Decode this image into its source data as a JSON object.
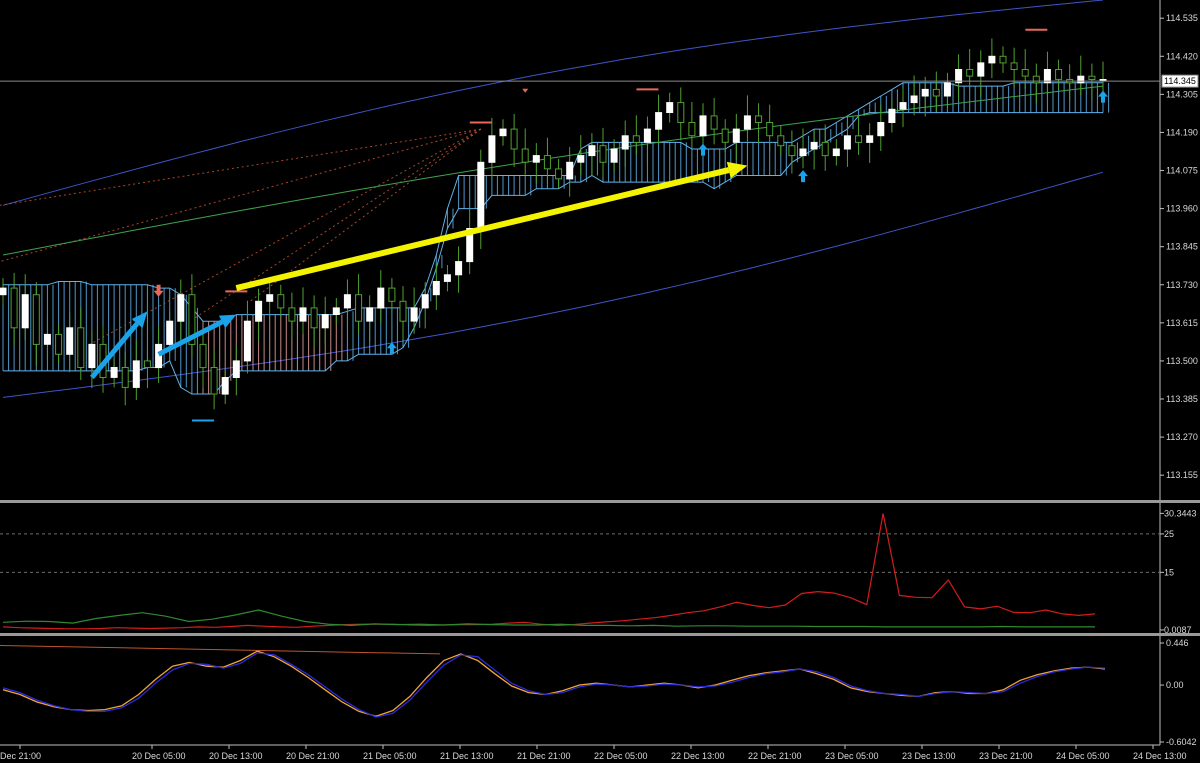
{
  "colors": {
    "background": "#000000",
    "axis": "#bfbfbf",
    "grid_dash": "#6e6e6e",
    "bull_candle": "#ffffff",
    "bear_candle": "#000000",
    "wick": "#4fa030",
    "cloud_bull": "#5fb2ea",
    "cloud_bear": "#e8a2a2",
    "bands": "#3f55c8",
    "ma": "#3fa34d",
    "fib_fan": "#b94f2c",
    "arrow_blue": "#1aa3e8",
    "arrow_yellow": "#f4f400",
    "fractal_up": "#e9685a",
    "fractal_down": "#1aa3e8",
    "adx_red": "#d21d1d",
    "adx_green": "#2f8a2f",
    "osc_orange": "#f0a43a",
    "osc_blue": "#2b2bd8"
  },
  "chart_data": [
    {
      "panel": "price",
      "type": "candlestick",
      "ylim": [
        113.08,
        114.59
      ],
      "tick_labels": [
        "114.535",
        "114.420",
        "114.305",
        "114.190",
        "114.075",
        "113.960",
        "113.845",
        "113.730",
        "113.615",
        "113.500",
        "113.385",
        "113.270",
        "113.155"
      ],
      "current_price_label": "114.345",
      "current_price": 114.345,
      "x_tick_labels": [
        "Dec 21:00",
        "20 Dec 05:00",
        "20 Dec 13:00",
        "20 Dec 21:00",
        "21 Dec 05:00",
        "21 Dec 13:00",
        "21 Dec 21:00",
        "22 Dec 05:00",
        "22 Dec 13:00",
        "22 Dec 21:00",
        "23 Dec 05:00",
        "23 Dec 13:00",
        "23 Dec 21:00",
        "24 Dec 05:00",
        "24 Dec 13:00"
      ],
      "closes": [
        113.72,
        113.6,
        113.7,
        113.55,
        113.58,
        113.52,
        113.6,
        113.48,
        113.55,
        113.45,
        113.48,
        113.42,
        113.5,
        113.48,
        113.55,
        113.62,
        113.7,
        113.55,
        113.48,
        113.4,
        113.45,
        113.5,
        113.62,
        113.68,
        113.7,
        113.66,
        113.62,
        113.66,
        113.6,
        113.64,
        113.66,
        113.7,
        113.62,
        113.66,
        113.72,
        113.68,
        113.62,
        113.66,
        113.7,
        113.74,
        113.76,
        113.8,
        113.9,
        114.1,
        114.18,
        114.2,
        114.14,
        114.1,
        114.12,
        114.08,
        114.05,
        114.1,
        114.12,
        114.15,
        114.1,
        114.14,
        114.18,
        114.16,
        114.2,
        114.25,
        114.28,
        114.22,
        114.18,
        114.24,
        114.2,
        114.16,
        114.2,
        114.24,
        114.22,
        114.18,
        114.15,
        114.12,
        114.14,
        114.16,
        114.12,
        114.14,
        114.18,
        114.16,
        114.18,
        114.22,
        114.26,
        114.28,
        114.3,
        114.32,
        114.3,
        114.34,
        114.38,
        114.36,
        114.4,
        114.42,
        114.4,
        114.38,
        114.36,
        114.34,
        114.38,
        114.35,
        114.34,
        114.36,
        114.35,
        114.35
      ],
      "cloud": {
        "top": [
          113.73,
          113.73,
          113.73,
          113.73,
          113.73,
          113.74,
          113.74,
          113.74,
          113.73,
          113.73,
          113.73,
          113.73,
          113.73,
          113.73,
          113.72,
          113.72,
          113.7,
          113.66,
          113.62,
          113.62,
          113.62,
          113.64,
          113.64,
          113.64,
          113.64,
          113.64,
          113.64,
          113.64,
          113.64,
          113.64,
          113.64,
          113.65,
          113.66,
          113.66,
          113.66,
          113.66,
          113.66,
          113.66,
          113.72,
          113.82,
          113.96,
          114.06,
          114.06,
          114.06,
          114.06,
          114.06,
          114.06,
          114.06,
          114.06,
          114.06,
          114.06,
          114.06,
          114.14,
          114.16,
          114.16,
          114.16,
          114.16,
          114.16,
          114.16,
          114.16,
          114.16,
          114.16,
          114.14,
          114.14,
          114.14,
          114.14,
          114.16,
          114.16,
          114.16,
          114.16,
          114.16,
          114.16,
          114.18,
          114.2,
          114.2,
          114.22,
          114.24,
          114.26,
          114.28,
          114.3,
          114.32,
          114.34,
          114.34,
          114.34,
          114.34,
          114.34,
          114.33,
          114.33,
          114.33,
          114.33,
          114.33,
          114.34,
          114.34,
          114.34,
          114.34,
          114.34,
          114.34,
          114.34,
          114.34,
          114.34
        ],
        "bottom": [
          113.47,
          113.47,
          113.47,
          113.47,
          113.47,
          113.47,
          113.47,
          113.47,
          113.47,
          113.47,
          113.47,
          113.47,
          113.47,
          113.48,
          113.48,
          113.5,
          113.42,
          113.4,
          113.4,
          113.4,
          113.44,
          113.47,
          113.47,
          113.47,
          113.47,
          113.47,
          113.47,
          113.47,
          113.47,
          113.47,
          113.5,
          113.5,
          113.52,
          113.52,
          113.52,
          113.52,
          113.54,
          113.6,
          113.68,
          113.78,
          113.9,
          113.96,
          113.96,
          113.96,
          114.0,
          114.0,
          114.0,
          114.0,
          114.02,
          114.02,
          114.02,
          114.04,
          114.04,
          114.06,
          114.04,
          114.04,
          114.04,
          114.04,
          114.04,
          114.04,
          114.04,
          114.04,
          114.04,
          114.04,
          114.02,
          114.04,
          114.06,
          114.06,
          114.06,
          114.06,
          114.06,
          114.1,
          114.12,
          114.14,
          114.16,
          114.18,
          114.2,
          114.24,
          114.25,
          114.25,
          114.25,
          114.25,
          114.25,
          114.25,
          114.25,
          114.25,
          114.25,
          114.25,
          114.25,
          114.25,
          114.25,
          114.25,
          114.25,
          114.25,
          114.25,
          114.25,
          114.25,
          114.25,
          114.25,
          114.25
        ]
      },
      "bollinger_upper_start": 113.97,
      "bollinger_upper_end": 114.59,
      "bollinger_lower_start": 113.39,
      "bollinger_lower_end": 114.07,
      "ma_start": 113.82,
      "ma_end": 114.33
    },
    {
      "panel": "adx",
      "type": "line",
      "ylim": [
        0,
        32
      ],
      "tick_labels": [
        "30.3443",
        "25",
        "15",
        "0.0087"
      ],
      "levels": [
        25,
        15
      ],
      "series": [
        {
          "values": [
            0.8,
            0.6,
            0.5,
            0.4,
            0.3,
            0.3,
            0.4,
            0.6,
            0.5,
            0.4,
            0.5,
            0.6,
            0.8,
            0.7,
            0.9,
            1.2,
            1.0,
            0.8,
            0.7,
            1.0,
            1.2,
            1.4,
            1.5,
            1.5,
            1.5,
            1.3,
            1.2,
            1.3,
            1.4,
            1.4,
            1.5,
            1.8,
            2.0,
            1.5,
            1.2,
            1.4,
            1.8,
            2.1,
            2.4,
            2.8,
            3.2,
            3.8,
            4.5,
            5.0,
            6.0,
            7.2,
            6.4,
            5.8,
            6.5,
            9.5,
            10.0,
            9.6,
            8.4,
            6.6,
            30.3,
            9.0,
            8.5,
            8.4,
            13.0,
            6.0,
            5.5,
            6.2,
            4.6,
            4.5,
            5.2,
            4.2,
            3.8,
            4.2
          ]
        },
        {
          "values": [
            2.0,
            2.3,
            2.2,
            1.8,
            3.0,
            3.8,
            4.5,
            3.6,
            2.2,
            2.8,
            3.9,
            5.2,
            3.6,
            2.2,
            1.5,
            1.2,
            1.6,
            1.4,
            1.5,
            1.3,
            1.6,
            1.4,
            1.3,
            1.3,
            1.5,
            1.2,
            1.2,
            1.1,
            1.2,
            1.0,
            1.1,
            1.1,
            1.0,
            1.0,
            1.0,
            0.9,
            0.9,
            0.9,
            0.8,
            0.8,
            0.8,
            0.8,
            0.8,
            0.9,
            0.8,
            0.8,
            0.8,
            0.8
          ]
        }
      ]
    },
    {
      "panel": "oscillator",
      "type": "line",
      "ylim": [
        -0.6042,
        0.446
      ],
      "tick_labels": [
        "0.446",
        "0.00",
        "-0.6042"
      ],
      "series": [
        {
          "values": [
            -0.05,
            -0.1,
            -0.18,
            -0.23,
            -0.26,
            -0.27,
            -0.26,
            -0.22,
            -0.1,
            0.06,
            0.2,
            0.24,
            0.2,
            0.19,
            0.26,
            0.36,
            0.3,
            0.2,
            0.08,
            -0.05,
            -0.18,
            -0.28,
            -0.33,
            -0.27,
            -0.12,
            0.08,
            0.26,
            0.33,
            0.26,
            0.12,
            -0.01,
            -0.08,
            -0.1,
            -0.06,
            0.0,
            0.02,
            0.0,
            -0.02,
            0.0,
            0.02,
            0.0,
            -0.03,
            0.0,
            0.05,
            0.1,
            0.13,
            0.15,
            0.17,
            0.12,
            0.06,
            -0.03,
            -0.07,
            -0.09,
            -0.11,
            -0.12,
            -0.08,
            -0.07,
            -0.09,
            -0.09,
            -0.05,
            0.05,
            0.11,
            0.15,
            0.18,
            0.19,
            0.17
          ]
        },
        {
          "values": [
            -0.03,
            -0.08,
            -0.16,
            -0.22,
            -0.26,
            -0.28,
            -0.28,
            -0.24,
            -0.14,
            0.02,
            0.16,
            0.23,
            0.22,
            0.18,
            0.23,
            0.34,
            0.32,
            0.22,
            0.11,
            -0.02,
            -0.15,
            -0.26,
            -0.34,
            -0.3,
            -0.16,
            0.03,
            0.21,
            0.32,
            0.3,
            0.16,
            0.02,
            -0.06,
            -0.1,
            -0.08,
            -0.02,
            0.01,
            0.0,
            -0.02,
            -0.01,
            0.01,
            0.0,
            -0.02,
            -0.01,
            0.03,
            0.08,
            0.12,
            0.14,
            0.17,
            0.14,
            0.08,
            -0.01,
            -0.06,
            -0.09,
            -0.1,
            -0.12,
            -0.09,
            -0.07,
            -0.08,
            -0.09,
            -0.07,
            0.02,
            0.09,
            0.14,
            0.17,
            0.19,
            0.18
          ]
        }
      ]
    }
  ]
}
